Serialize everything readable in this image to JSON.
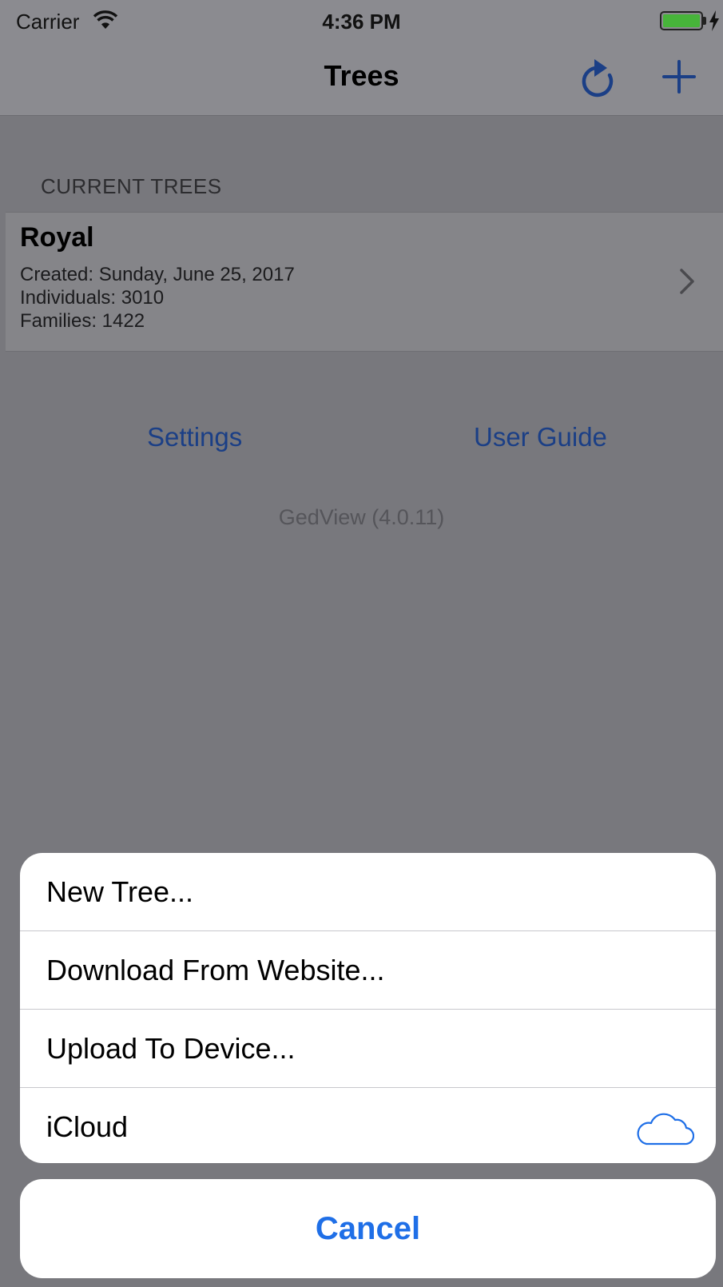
{
  "status_bar": {
    "carrier": "Carrier",
    "time": "4:36 PM",
    "wifi_icon": "wifi-icon",
    "battery_icon": "battery-charging-icon"
  },
  "nav": {
    "title": "Trees",
    "refresh_icon": "refresh-icon",
    "add_icon": "plus-icon",
    "tint": "#1b3f86"
  },
  "trees_section": {
    "header": "CURRENT TREES",
    "items": [
      {
        "name": "Royal",
        "created": "Created: Sunday, June 25, 2017",
        "individuals": "Individuals: 3010",
        "families": "Families: 1422"
      }
    ]
  },
  "links": {
    "settings": "Settings",
    "user_guide": "User Guide"
  },
  "version": "GedView (4.0.11)",
  "action_sheet": {
    "items": [
      {
        "label": "New Tree..."
      },
      {
        "label": "Download From Website..."
      },
      {
        "label": "Upload To Device..."
      },
      {
        "label": "iCloud",
        "icon": "cloud-icon"
      }
    ],
    "cancel": "Cancel",
    "accent": "#1f6fe7"
  }
}
